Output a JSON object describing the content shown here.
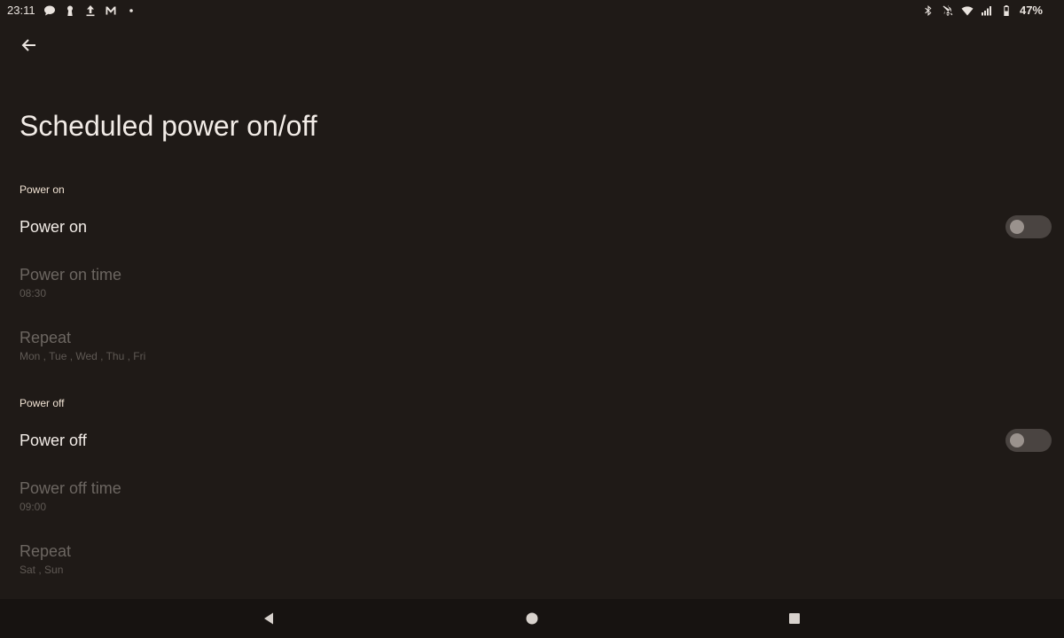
{
  "status_bar": {
    "time": "23:11",
    "left_icons": [
      "chat-bubble-icon",
      "keyhole-icon",
      "upload-icon",
      "gmail-icon",
      "dot-icon"
    ],
    "right_icons": [
      "bluetooth-icon",
      "notifications-off-icon",
      "wifi-icon",
      "signal-icon",
      "battery-icon"
    ],
    "battery": "47%"
  },
  "header": {
    "title": "Scheduled power on/off",
    "back_icon": "arrow-back-icon"
  },
  "power_on_section": {
    "header": "Power on",
    "toggle_label": "Power on",
    "toggle_on": false,
    "time_label": "Power on time",
    "time_value": "08:30",
    "repeat_label": "Repeat",
    "repeat_value": "Mon , Tue , Wed , Thu , Fri"
  },
  "power_off_section": {
    "header": "Power off",
    "toggle_label": "Power off",
    "toggle_on": false,
    "time_label": "Power off time",
    "time_value": "09:00",
    "repeat_label": "Repeat",
    "repeat_value": "Sat , Sun"
  },
  "nav_bar": {
    "buttons": [
      "back-triangle-icon",
      "home-circle-icon",
      "recents-square-icon"
    ]
  },
  "colors": {
    "background": "#1f1a17",
    "nav_background": "#171311",
    "disabled_text": "#6c6661",
    "section_header": "#f0e2d3"
  }
}
